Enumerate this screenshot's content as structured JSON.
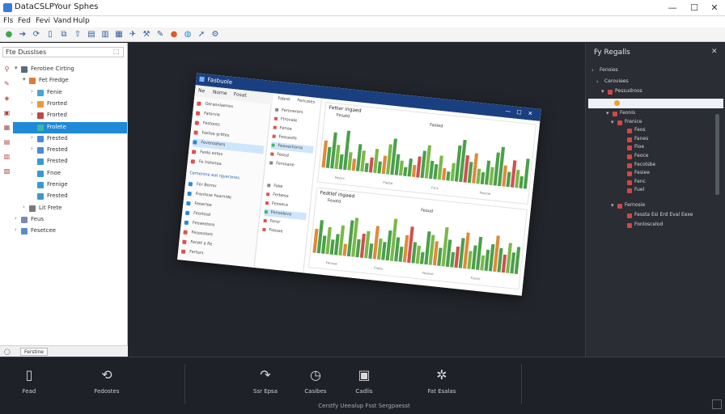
{
  "window": {
    "title": "DataCSLPYour Sphes",
    "controls": [
      "—",
      "☐",
      "✕"
    ]
  },
  "menu": [
    "Fls",
    "Fed",
    "Fevi",
    "Vand",
    "Hulp"
  ],
  "toolbar": {
    "icons": [
      "back-icon",
      "forward-icon",
      "refresh-icon",
      "document-icon",
      "split-icon",
      "upload-icon",
      "folder-icon",
      "columns-icon",
      "grid-icon",
      "pointer-icon",
      "tool-icon",
      "edit-icon",
      "record-icon",
      "globe-icon",
      "arrow-icon",
      "settings-icon"
    ],
    "glyphs": [
      "●",
      "➔",
      "⟳",
      "▯",
      "⧉",
      "⇧",
      "▤",
      "▥",
      "▦",
      "✈",
      "⚒",
      "✎",
      "●",
      "◍",
      "➚",
      "⚙"
    ]
  },
  "left_panel": {
    "search_value": "Fte Dusslses",
    "gutter_icons": [
      "pin-icon",
      "edit-icon",
      "layer-icon",
      "image-icon",
      "grid-icon",
      "stack-icon",
      "table-icon",
      "panel-icon"
    ],
    "gutter_glyphs": [
      "⚲",
      "✎",
      "◈",
      "▣",
      "▦",
      "▤",
      "▥",
      "▧"
    ],
    "tree": [
      {
        "label": "Ferotiee Cirting",
        "toggle": "▾",
        "color": "#5a6b7a",
        "indent": 0
      },
      {
        "label": "Fet Fredge",
        "toggle": "▾",
        "color": "#e0793a",
        "indent": 1
      },
      {
        "label": "Fenie",
        "toggle": "›",
        "color": "#4aa3d8",
        "indent": 2
      },
      {
        "label": "Frorted",
        "toggle": "›",
        "color": "#e89a3a",
        "indent": 2
      },
      {
        "label": "Frorted",
        "toggle": "›",
        "color": "#c04848",
        "indent": 2
      },
      {
        "label": "Frolete",
        "toggle": "",
        "color": "#3ab8a0",
        "indent": 2,
        "selected": true
      },
      {
        "label": "Frested",
        "toggle": "›",
        "color": "#4a8ad8",
        "indent": 2
      },
      {
        "label": "Frested",
        "toggle": "›",
        "color": "#4a8ad8",
        "indent": 2
      },
      {
        "label": "Frested",
        "toggle": "",
        "color": "#3a9ad0",
        "indent": 2
      },
      {
        "label": "Fnoe",
        "toggle": "",
        "color": "#3a9ad0",
        "indent": 2
      },
      {
        "label": "Frenige",
        "toggle": "",
        "color": "#3a9ad0",
        "indent": 2
      },
      {
        "label": "Frested",
        "toggle": "",
        "color": "#3a9ad0",
        "indent": 2
      },
      {
        "label": "Lit Frete",
        "toggle": "›",
        "color": "#7a7a7a",
        "indent": 1
      },
      {
        "label": "Feus",
        "toggle": "›",
        "color": "#7a8ab0",
        "indent": 0
      },
      {
        "label": "Fesetcee",
        "toggle": "›",
        "color": "#5a8ad0",
        "indent": 0
      }
    ],
    "status_button": "Ferstine"
  },
  "embedded": {
    "title": "Fasbuole",
    "tabs": [
      "Ne",
      "Nome",
      "Fosat"
    ],
    "sidebar": [
      {
        "label": "Geraovlaeries",
        "color": "#e05050"
      },
      {
        "label": "Fatorvie",
        "color": "#e05050"
      },
      {
        "label": "Festores",
        "color": "#e05050"
      },
      {
        "label": "Fastoo grittes",
        "color": "#e05050"
      },
      {
        "label": "Feveroafwrs",
        "color": "#2a8ad8",
        "selected": true
      },
      {
        "label": "Feolo estos",
        "color": "#e05050"
      },
      {
        "label": "Fe lrotonea",
        "color": "#e05050"
      }
    ],
    "sidebar_heading": "Cemenine eat rgyeraries",
    "sidebar2": [
      {
        "label": "Fer Borror",
        "color": "#2a8ad8"
      },
      {
        "label": "Frentese Fearnide",
        "color": "#2a8ad8"
      },
      {
        "label": "Feeerloe",
        "color": "#2a8ad8"
      },
      {
        "label": "Feorlosd",
        "color": "#2a8ad8"
      },
      {
        "label": "Feoseetore",
        "color": "#2a8ad8"
      },
      {
        "label": "Fesosolore",
        "color": "#e05050"
      },
      {
        "label": "Ferott a fle",
        "color": "#e05050"
      },
      {
        "label": "Fertors",
        "color": "#e05050"
      }
    ],
    "mid_tabs": [
      "Fabrel",
      "Fencoies"
    ],
    "mid_rows": [
      {
        "label": "Feronerers",
        "color": "#888888"
      },
      {
        "label": "Ftrovale",
        "color": "#e05050"
      },
      {
        "label": "Fenoe",
        "color": "#e05050"
      },
      {
        "label": "Feoseofe",
        "color": "#e05050"
      },
      {
        "label": "Feavectorna",
        "color": "#3ab870",
        "selected": true
      },
      {
        "label": "Feosd",
        "color": "#e05050"
      },
      {
        "label": "Fersoane",
        "color": "#888888"
      }
    ],
    "mid_rows2": [
      {
        "label": "Fake",
        "color": "#888888"
      },
      {
        "label": "Ferbeos",
        "color": "#e05050"
      },
      {
        "label": "Feosece",
        "color": "#e05050"
      },
      {
        "label": "Fenooleva",
        "color": "#3ab870",
        "selected": true
      },
      {
        "label": "Feror",
        "color": "#e05050"
      },
      {
        "label": "Foesse",
        "color": "#e05050"
      }
    ],
    "charts": [
      {
        "title": "Fetter ingaed",
        "label_left": "Fesatd",
        "label_right": "Fasted",
        "footer": [
          "Fessrc",
          "Fleste",
          "Fscs",
          "Fassoe"
        ]
      },
      {
        "title": "Fedtlef ingaed",
        "label_left": "Fesotd",
        "label_right": "Feoud",
        "footer": [
          "Fenose",
          "Foess",
          "Feasse",
          "Fsosic"
        ]
      }
    ]
  },
  "chart_data": [
    {
      "type": "bar",
      "title": "Fetter ingaed",
      "series": [
        {
          "values": [
            9,
            7,
            12,
            8,
            5,
            13,
            6,
            4,
            9,
            7,
            3,
            5,
            8,
            4,
            6,
            10,
            12,
            7,
            5,
            3,
            6,
            4,
            7,
            9,
            11,
            6,
            5,
            8,
            4,
            3,
            6,
            12,
            14,
            9,
            7,
            10,
            5,
            4,
            8,
            6,
            11,
            13,
            7,
            5,
            9,
            6,
            4,
            10
          ]
        }
      ],
      "ylim": [
        0,
        15
      ]
    },
    {
      "type": "bar",
      "title": "Fedtlef ingaed",
      "series": [
        {
          "values": [
            8,
            11,
            6,
            9,
            5,
            7,
            10,
            4,
            12,
            13,
            6,
            8,
            9,
            5,
            11,
            7,
            6,
            10,
            14,
            8,
            5,
            9,
            12,
            7,
            6,
            4,
            11,
            10,
            8,
            6,
            13,
            9,
            5,
            7,
            10,
            12,
            6,
            8,
            11,
            5,
            7,
            9,
            12,
            8,
            6,
            10,
            7,
            9
          ]
        }
      ],
      "ylim": [
        0,
        15
      ]
    }
  ],
  "right_panel": {
    "title": "Fy Regalls",
    "rows": [
      {
        "toggle": "›",
        "label": "Fenoies",
        "x": 8,
        "icon": false
      },
      {
        "toggle": "›",
        "label": "Ceroviees",
        "x": 14,
        "icon": false
      },
      {
        "toggle": "▾",
        "label": "Pessudroos",
        "x": 20,
        "icon": true
      },
      {
        "toggle": "▾",
        "label": "Feonis",
        "x": 26,
        "icon": true
      },
      {
        "toggle": "▾",
        "label": "Frenice",
        "x": 32,
        "icon": true
      },
      {
        "toggle": "",
        "label": "Feos",
        "x": 44,
        "icon": true
      },
      {
        "toggle": "",
        "label": "Fanes",
        "x": 44,
        "icon": true
      },
      {
        "toggle": "",
        "label": "Fioe",
        "x": 44,
        "icon": true
      },
      {
        "toggle": "",
        "label": "Feoce",
        "x": 44,
        "icon": true
      },
      {
        "toggle": "",
        "label": "Fecolsbe",
        "x": 44,
        "icon": true
      },
      {
        "toggle": "",
        "label": "Fesiee",
        "x": 44,
        "icon": true
      },
      {
        "toggle": "",
        "label": "Fenc",
        "x": 44,
        "icon": true
      },
      {
        "toggle": "",
        "label": "Fuel",
        "x": 44,
        "icon": true
      },
      {
        "toggle": "▾",
        "label": "Fernosie",
        "x": 32,
        "icon": true
      },
      {
        "toggle": "",
        "label": "Fessta Esi Erd Eval Eexe",
        "x": 44,
        "icon": true
      },
      {
        "toggle": "",
        "label": "Fonloscelod",
        "x": 44,
        "icon": true
      }
    ]
  },
  "dock": {
    "items": [
      {
        "label": "Fead",
        "glyph": "▯",
        "name": "panels-icon"
      },
      {
        "label": "Fedostes",
        "glyph": "⟲",
        "name": "history-icon"
      },
      {
        "label": "Ssr Epsa",
        "glyph": "↷",
        "name": "redo-icon"
      },
      {
        "label": "Casibes",
        "glyph": "◷",
        "name": "clock-icon"
      },
      {
        "label": "Cadlis",
        "glyph": "▣",
        "name": "calendar-icon"
      },
      {
        "label": "Fat Esalas",
        "glyph": "✲",
        "name": "settings-icon"
      }
    ],
    "status": "Cerstfy Ueealup Fsst Sergpaesst"
  }
}
